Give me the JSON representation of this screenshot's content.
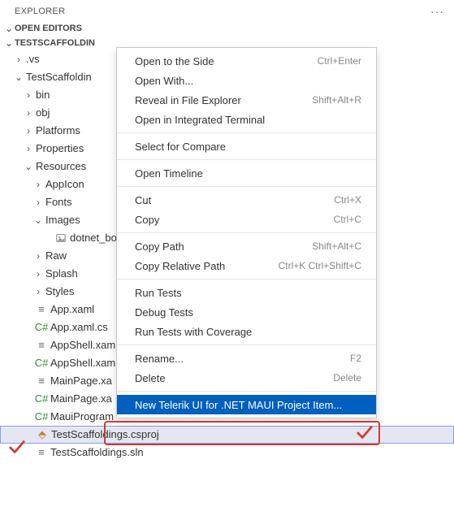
{
  "panel": {
    "title": "EXPLORER"
  },
  "sections": {
    "open_editors": "OPEN EDITORS",
    "project": "TESTSCAFFOLDIN"
  },
  "tree": {
    "vs": ".vs",
    "root": "TestScaffoldin",
    "bin": "bin",
    "obj": "obj",
    "platforms": "Platforms",
    "properties": "Properties",
    "resources": "Resources",
    "appicon": "AppIcon",
    "fonts": "Fonts",
    "images": "Images",
    "dotnet_bo": "dotnet_bo",
    "raw": "Raw",
    "splash": "Splash",
    "styles": "Styles",
    "app_xaml": "App.xaml",
    "app_xaml_cs": "App.xaml.cs",
    "appshell_xaml": "AppShell.xam",
    "appshell_xaml_cs": "AppShell.xam",
    "mainpage_xaml": "MainPage.xa",
    "mainpage_xaml_cs": "MainPage.xa",
    "mauiprogram": "MauiProgram",
    "csproj": "TestScaffoldings.csproj",
    "sln": "TestScaffoldings.sln"
  },
  "menu": {
    "open_side": {
      "label": "Open to the Side",
      "shortcut": "Ctrl+Enter"
    },
    "open_with": {
      "label": "Open With..."
    },
    "reveal": {
      "label": "Reveal in File Explorer",
      "shortcut": "Shift+Alt+R"
    },
    "terminal": {
      "label": "Open in Integrated Terminal"
    },
    "compare": {
      "label": "Select for Compare"
    },
    "timeline": {
      "label": "Open Timeline"
    },
    "cut": {
      "label": "Cut",
      "shortcut": "Ctrl+X"
    },
    "copy": {
      "label": "Copy",
      "shortcut": "Ctrl+C"
    },
    "copy_path": {
      "label": "Copy Path",
      "shortcut": "Shift+Alt+C"
    },
    "copy_rel": {
      "label": "Copy Relative Path",
      "shortcut": "Ctrl+K Ctrl+Shift+C"
    },
    "run_tests": {
      "label": "Run Tests"
    },
    "debug_tests": {
      "label": "Debug Tests"
    },
    "coverage": {
      "label": "Run Tests with Coverage"
    },
    "rename": {
      "label": "Rename...",
      "shortcut": "F2"
    },
    "delete": {
      "label": "Delete",
      "shortcut": "Delete"
    },
    "telerik": {
      "label": "New Telerik UI for .NET MAUI Project Item..."
    }
  }
}
